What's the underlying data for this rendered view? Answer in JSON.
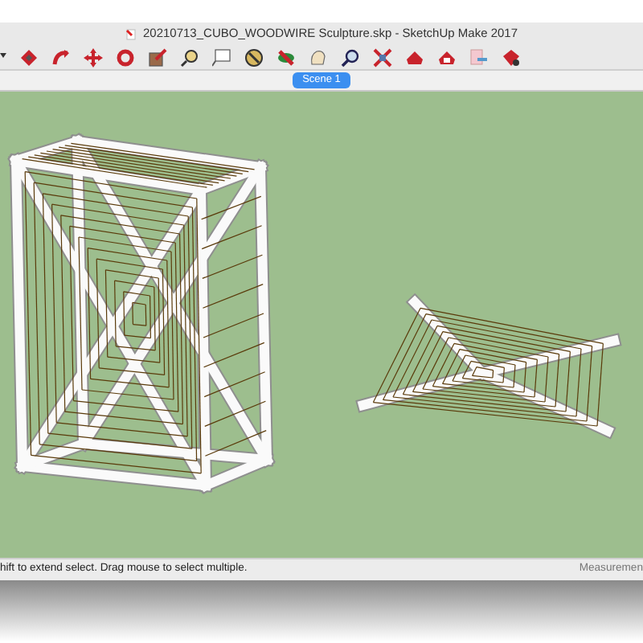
{
  "window": {
    "title": "20210713_CUBO_WOODWIRE Sculpture.skp - SketchUp Make 2017"
  },
  "scene_tabs": [
    {
      "label": "Scene 1",
      "selected": true
    }
  ],
  "status_bar": {
    "hint": "hift to extend select. Drag mouse to select multiple.",
    "measurements_label": "Measuremen"
  }
}
